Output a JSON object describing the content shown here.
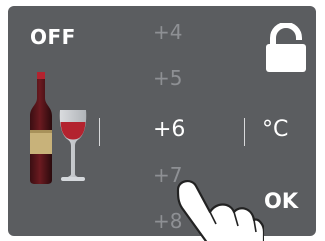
{
  "power": {
    "label": "OFF"
  },
  "lock": {
    "icon": "lock-icon"
  },
  "wine": {
    "icon": "wine-bottle-and-glass-icon"
  },
  "temperature": {
    "options": [
      "+4",
      "+5",
      "+6",
      "+7",
      "+8"
    ],
    "selected": "+6",
    "unit": "°C"
  },
  "confirm": {
    "label": "OK"
  },
  "colors": {
    "panel": "#5b5d60",
    "text": "#ffffff",
    "faded_text": "#8e9094",
    "wine": "#b3232f"
  }
}
